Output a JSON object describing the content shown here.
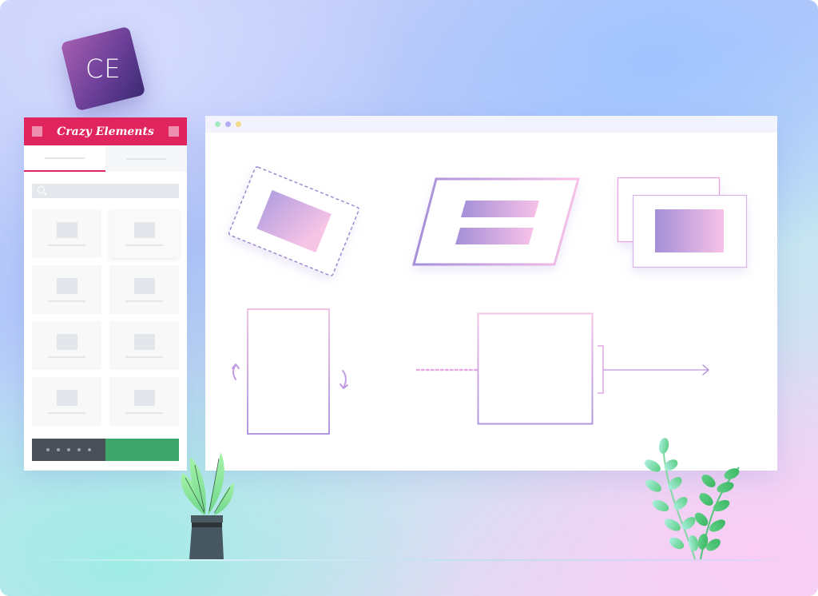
{
  "app": {
    "logo_text": "CE",
    "brand_name": "Crazy Elements"
  },
  "panel": {
    "tabs": [
      {
        "state": "active"
      },
      {
        "state": "inactive"
      }
    ],
    "search_icon": "search-icon",
    "widget_count": 8,
    "footer": {
      "dots": 5,
      "colors": {
        "dark": "#4a5058",
        "green": "#3da66a"
      }
    },
    "header_color": "#e0245e"
  },
  "browser": {
    "window_dots": [
      {
        "name": "green",
        "color": "#a6e9c0"
      },
      {
        "name": "purple",
        "color": "#b3aef4"
      },
      {
        "name": "yellow",
        "color": "#f3d98a"
      }
    ],
    "illustrations": [
      "rotated-dashed-frame",
      "skewed-frame-with-bars",
      "stacked-frames",
      "rotate-rectangle",
      "motion-box-arrow"
    ]
  },
  "colors": {
    "gradient_start": "#a48fd8",
    "gradient_end": "#f8c2e8",
    "accent_pink": "#e0245e"
  }
}
